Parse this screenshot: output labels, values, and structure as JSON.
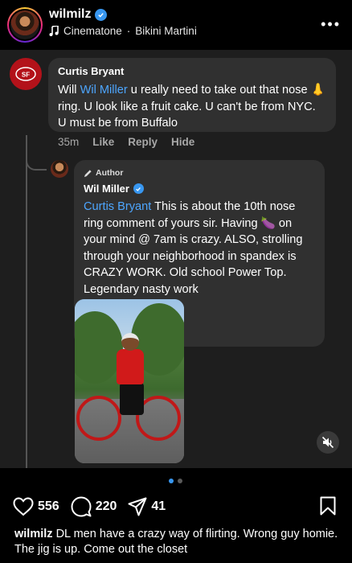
{
  "header": {
    "username": "wilmilz",
    "music_artist": "Cinematone",
    "music_separator": "·",
    "music_title": "Bikini Martini",
    "more_icon": "more-horizontal-icon"
  },
  "comment": {
    "author": "Curtis Bryant",
    "text_part1": "Will ",
    "mention": "Wil Miller",
    "text_part2": " u really need to take out that nose 👃 ring. U look like a fruit cake. U can't be from NYC. U must be from Buffalo",
    "time": "35m",
    "like_label": "Like",
    "reply_label": "Reply",
    "hide_label": "Hide"
  },
  "reply": {
    "author_tag": "Author",
    "author": "Wil Miller",
    "mention": "Curtis Bryant",
    "text": "  This is about the 10th nose ring comment of yours sir. Having 🍆 on your mind @ 7am is crazy. ALSO, strolling through your neighborhood in spandex is CRAZY WORK. Old school Power Top. Legendary nasty work"
  },
  "post": {
    "likes": "556",
    "comments": "220",
    "shares": "41",
    "caption_user": "wilmilz",
    "caption_text": " DL men have a crazy way of flirting. Wrong guy homie. The jig is up. Come out the closet"
  },
  "carousel": {
    "total": 2,
    "active": 1
  },
  "colors": {
    "accent": "#3897f0",
    "mention": "#4da6ff",
    "panel": "#1e1e1e",
    "bubble": "#303030"
  }
}
